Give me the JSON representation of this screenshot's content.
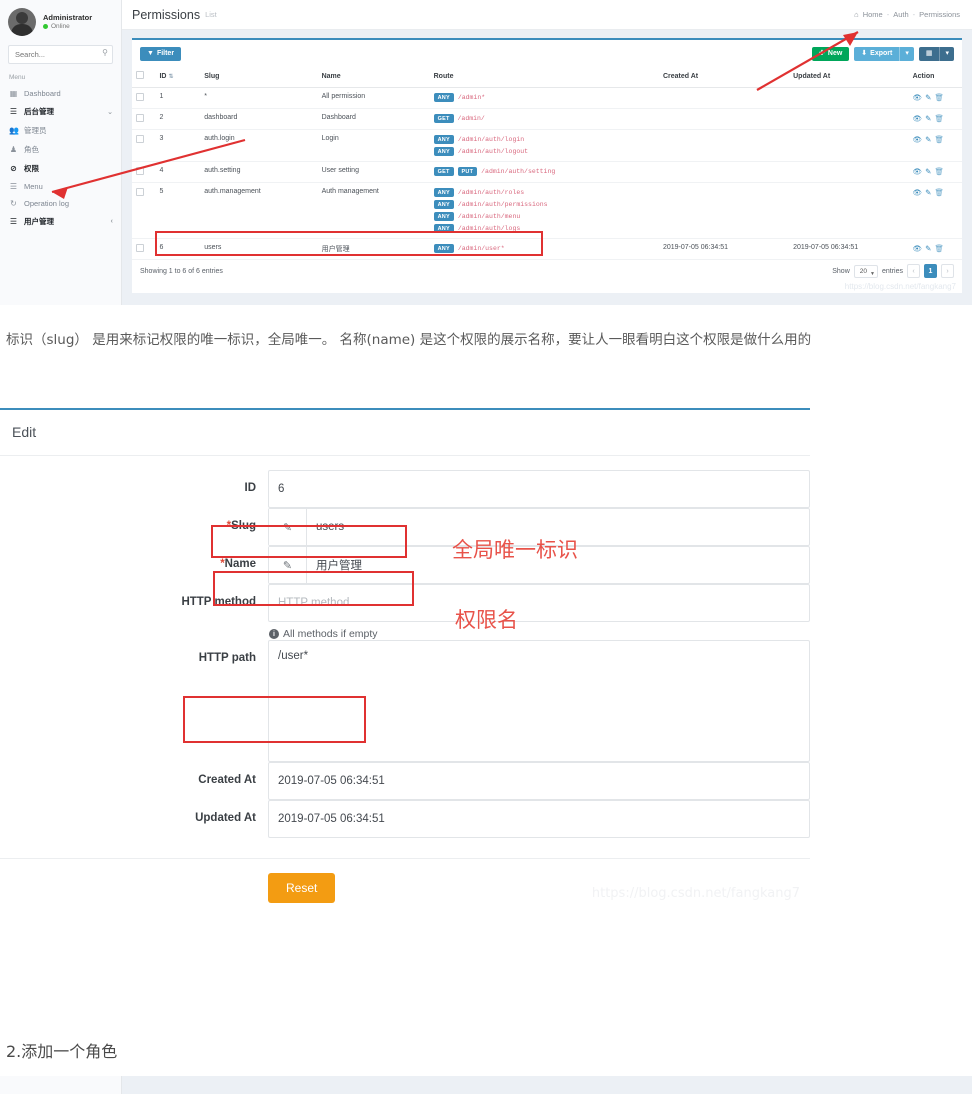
{
  "shot1": {
    "user": {
      "name": "Administrator",
      "status": "Online",
      "avatar_icon": "user-avatar"
    },
    "search": {
      "placeholder": "Search...",
      "value": "",
      "icon": "search-icon"
    },
    "sidebar": {
      "section_label": "Menu",
      "items": [
        {
          "label": "Dashboard",
          "icon": "chart-bar-icon",
          "style": "normal"
        },
        {
          "label": "后台管理",
          "icon": "layers-icon",
          "style": "strong",
          "caret": "⌄"
        },
        {
          "label": "管理员",
          "icon": "users-icon",
          "style": "normal"
        },
        {
          "label": "角色",
          "icon": "user-icon",
          "style": "normal"
        },
        {
          "label": "权限",
          "icon": "ban-icon",
          "style": "active"
        },
        {
          "label": "Menu",
          "icon": "list-icon",
          "style": "normal"
        },
        {
          "label": "Operation log",
          "icon": "history-icon",
          "style": "normal"
        },
        {
          "label": "用户管理",
          "icon": "list-alt-icon",
          "style": "strong",
          "caret": "‹"
        }
      ]
    },
    "header": {
      "title": "Permissions",
      "subtitle": "List",
      "breadcrumb": [
        "Home",
        "Auth",
        "Permissions"
      ],
      "home_icon": "home-icon"
    },
    "toolbar": {
      "filter_label": "Filter",
      "filter_icon": "filter-icon",
      "new_label": "New",
      "new_icon": "plus-icon",
      "export_label": "Export",
      "export_icon": "download-icon",
      "caret_icon": "caret-down-icon",
      "columns_icon": "columns-icon"
    },
    "table": {
      "columns": [
        "",
        "ID",
        "Slug",
        "Name",
        "Route",
        "Created At",
        "Updated At",
        "Action"
      ],
      "sort_icon": "sort-icon",
      "action_icons": [
        "eye-icon",
        "edit-icon",
        "trash-icon"
      ],
      "rows": [
        {
          "id": "1",
          "slug": "*",
          "name": "All permission",
          "routes": [
            {
              "verb": "ANY",
              "path": "/admin*"
            }
          ],
          "created_at": "",
          "updated_at": ""
        },
        {
          "id": "2",
          "slug": "dashboard",
          "name": "Dashboard",
          "routes": [
            {
              "verb": "GET",
              "path": "/admin/"
            }
          ],
          "created_at": "",
          "updated_at": ""
        },
        {
          "id": "3",
          "slug": "auth.login",
          "name": "Login",
          "routes": [
            {
              "verb": "ANY",
              "path": "/admin/auth/login"
            },
            {
              "verb": "ANY",
              "path": "/admin/auth/logout"
            }
          ],
          "created_at": "",
          "updated_at": ""
        },
        {
          "id": "4",
          "slug": "auth.setting",
          "name": "User setting",
          "routes": [
            {
              "verb": "GET",
              "path": ""
            },
            {
              "verb": "PUT",
              "path": "/admin/auth/setting"
            }
          ],
          "created_at": "",
          "updated_at": ""
        },
        {
          "id": "5",
          "slug": "auth.management",
          "name": "Auth management",
          "routes": [
            {
              "verb": "ANY",
              "path": "/admin/auth/roles"
            },
            {
              "verb": "ANY",
              "path": "/admin/auth/permissions"
            },
            {
              "verb": "ANY",
              "path": "/admin/auth/menu"
            },
            {
              "verb": "ANY",
              "path": "/admin/auth/logs"
            }
          ],
          "created_at": "",
          "updated_at": ""
        },
        {
          "id": "6",
          "slug": "users",
          "name": "用户管理",
          "routes": [
            {
              "verb": "ANY",
              "path": "/admin/user*"
            }
          ],
          "created_at": "2019-07-05 06:34:51",
          "updated_at": "2019-07-05 06:34:51"
        }
      ]
    },
    "footer": {
      "showing": "Showing 1 to 6 of 6 entries",
      "show_label": "Show",
      "page_size": "20",
      "entries_label": "entries",
      "prev": "‹",
      "current_page": "1",
      "next": "›"
    },
    "watermark": "https://blog.csdn.net/fangkang7"
  },
  "paragraph": "标识（slug） 是用来标记权限的唯一标识，全局唯一。 名称(name) 是这个权限的展示名称，要让人一眼看明白这个权限是做什么用的",
  "shot2": {
    "title": "Edit",
    "fields": [
      {
        "label": "ID",
        "required": false,
        "value": "6",
        "placeholder": "",
        "addon": null,
        "tall": false
      },
      {
        "label": "Slug",
        "required": true,
        "value": "users",
        "placeholder": "",
        "addon": "pencil-icon",
        "tall": false
      },
      {
        "label": "Name",
        "required": true,
        "value": "用户管理",
        "placeholder": "",
        "addon": "pencil-icon",
        "tall": false
      },
      {
        "label": "HTTP method",
        "required": false,
        "value": "",
        "placeholder": "HTTP method",
        "addon": null,
        "tall": false,
        "help": "All methods if empty",
        "help_icon": "info-icon"
      },
      {
        "label": "HTTP path",
        "required": false,
        "value": "/user*",
        "placeholder": "",
        "addon": null,
        "tall": true
      },
      {
        "label": "Created At",
        "required": false,
        "value": "2019-07-05 06:34:51",
        "placeholder": "",
        "addon": null,
        "tall": false
      },
      {
        "label": "Updated At",
        "required": false,
        "value": "2019-07-05 06:34:51",
        "placeholder": "",
        "addon": null,
        "tall": false
      }
    ],
    "reset_label": "Reset",
    "watermark": "https://blog.csdn.net/fangkang7"
  },
  "annotations": {
    "slug_note": "全局唯一标识",
    "name_note": "权限名",
    "accent_red": "#e03131",
    "text_red": "#e8534a"
  },
  "bottom_heading": "2.添加一个角色"
}
